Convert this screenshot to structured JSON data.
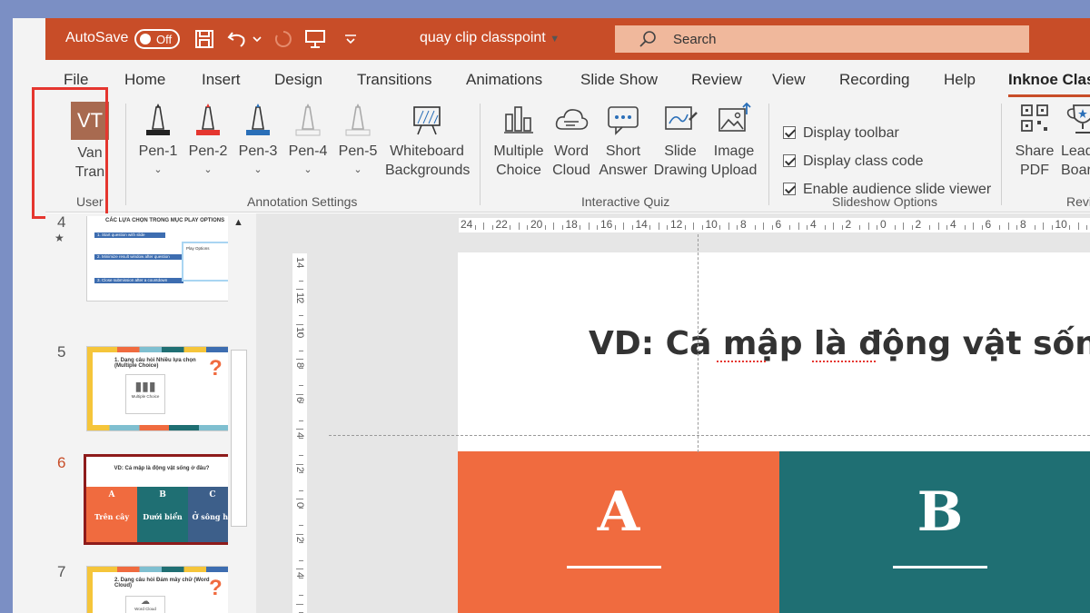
{
  "titlebar": {
    "autosave_label": "AutoSave",
    "autosave_state": "Off",
    "document_name": "quay clip classpoint",
    "search_placeholder": "Search"
  },
  "tabs": [
    "File",
    "Home",
    "Insert",
    "Design",
    "Transitions",
    "Animations",
    "Slide Show",
    "Review",
    "View",
    "Recording",
    "Help",
    "Inknoe Clas"
  ],
  "active_tab": "Inknoe Clas",
  "ribbon": {
    "user": {
      "initials": "VT",
      "first": "Van",
      "last": "Tran",
      "group": "User"
    },
    "annotation": {
      "pens": [
        {
          "label": "Pen-1",
          "color": "#222222"
        },
        {
          "label": "Pen-2",
          "color": "#e5362f"
        },
        {
          "label": "Pen-3",
          "color": "#2a6fb8"
        },
        {
          "label": "Pen-4",
          "color": "#bbbbbb"
        },
        {
          "label": "Pen-5",
          "color": "#bbbbbb"
        }
      ],
      "whiteboard_line1": "Whiteboard",
      "whiteboard_line2": "Backgrounds",
      "group": "Annotation Settings"
    },
    "quiz": {
      "buttons": [
        {
          "l1": "Multiple",
          "l2": "Choice"
        },
        {
          "l1": "Word",
          "l2": "Cloud"
        },
        {
          "l1": "Short",
          "l2": "Answer"
        },
        {
          "l1": "Slide",
          "l2": "Drawing"
        },
        {
          "l1": "Image",
          "l2": "Upload"
        }
      ],
      "group": "Interactive Quiz"
    },
    "slideshow": {
      "options": [
        "Display toolbar",
        "Display class code",
        "Enable audience slide viewer"
      ],
      "group": "Slideshow Options"
    },
    "review": {
      "share_l1": "Share",
      "share_l2": "PDF",
      "leader_l1": "Leader",
      "leader_l2": "Board",
      "group": "Revie"
    }
  },
  "thumbnails": [
    {
      "num": "4",
      "title": "CÁC LỰA CHỌN TRONG MỤC PLAY OPTIONS",
      "items": [
        "1. Start question with slide",
        "2. Minimize result window after question",
        "3. Close submission after a countdown"
      ],
      "side_title": "Play Options"
    },
    {
      "num": "5",
      "title": "1. Dạng câu hỏi Nhiều lựa chọn (Multiple Choice)",
      "icon_label": "Multiple Choice"
    },
    {
      "num": "6",
      "title": "VD: Cá mập là động vật sống ở đâu?",
      "options": [
        {
          "letter": "A",
          "text": "Trên cây"
        },
        {
          "letter": "B",
          "text": "Dưới biển"
        },
        {
          "letter": "C",
          "text": "Ở sông hồ"
        }
      ]
    },
    {
      "num": "7",
      "title": "2. Dạng câu hỏi Đám mây chữ (Word Cloud)",
      "icon_label": "Word Cloud"
    }
  ],
  "ruler": {
    "h_labels": [
      "24",
      "22",
      "20",
      "18",
      "16",
      "14",
      "12",
      "10",
      "8",
      "6",
      "4",
      "2",
      "0",
      "2",
      "4",
      "6",
      "8",
      "10",
      "12"
    ],
    "v_labels": [
      "14",
      "12",
      "10",
      "8",
      "6",
      "4",
      "2",
      "0",
      "2",
      "4"
    ]
  },
  "slide": {
    "question": "VD: Cá mập là động vật sống ở",
    "options": [
      {
        "letter": "A",
        "color": "#f06b3f"
      },
      {
        "letter": "B",
        "color": "#1f6f73"
      }
    ]
  },
  "colors": {
    "titlebar": "#c84d28",
    "user_highlight": "#e5362f",
    "selected_thumb": "#8e1b1b"
  }
}
